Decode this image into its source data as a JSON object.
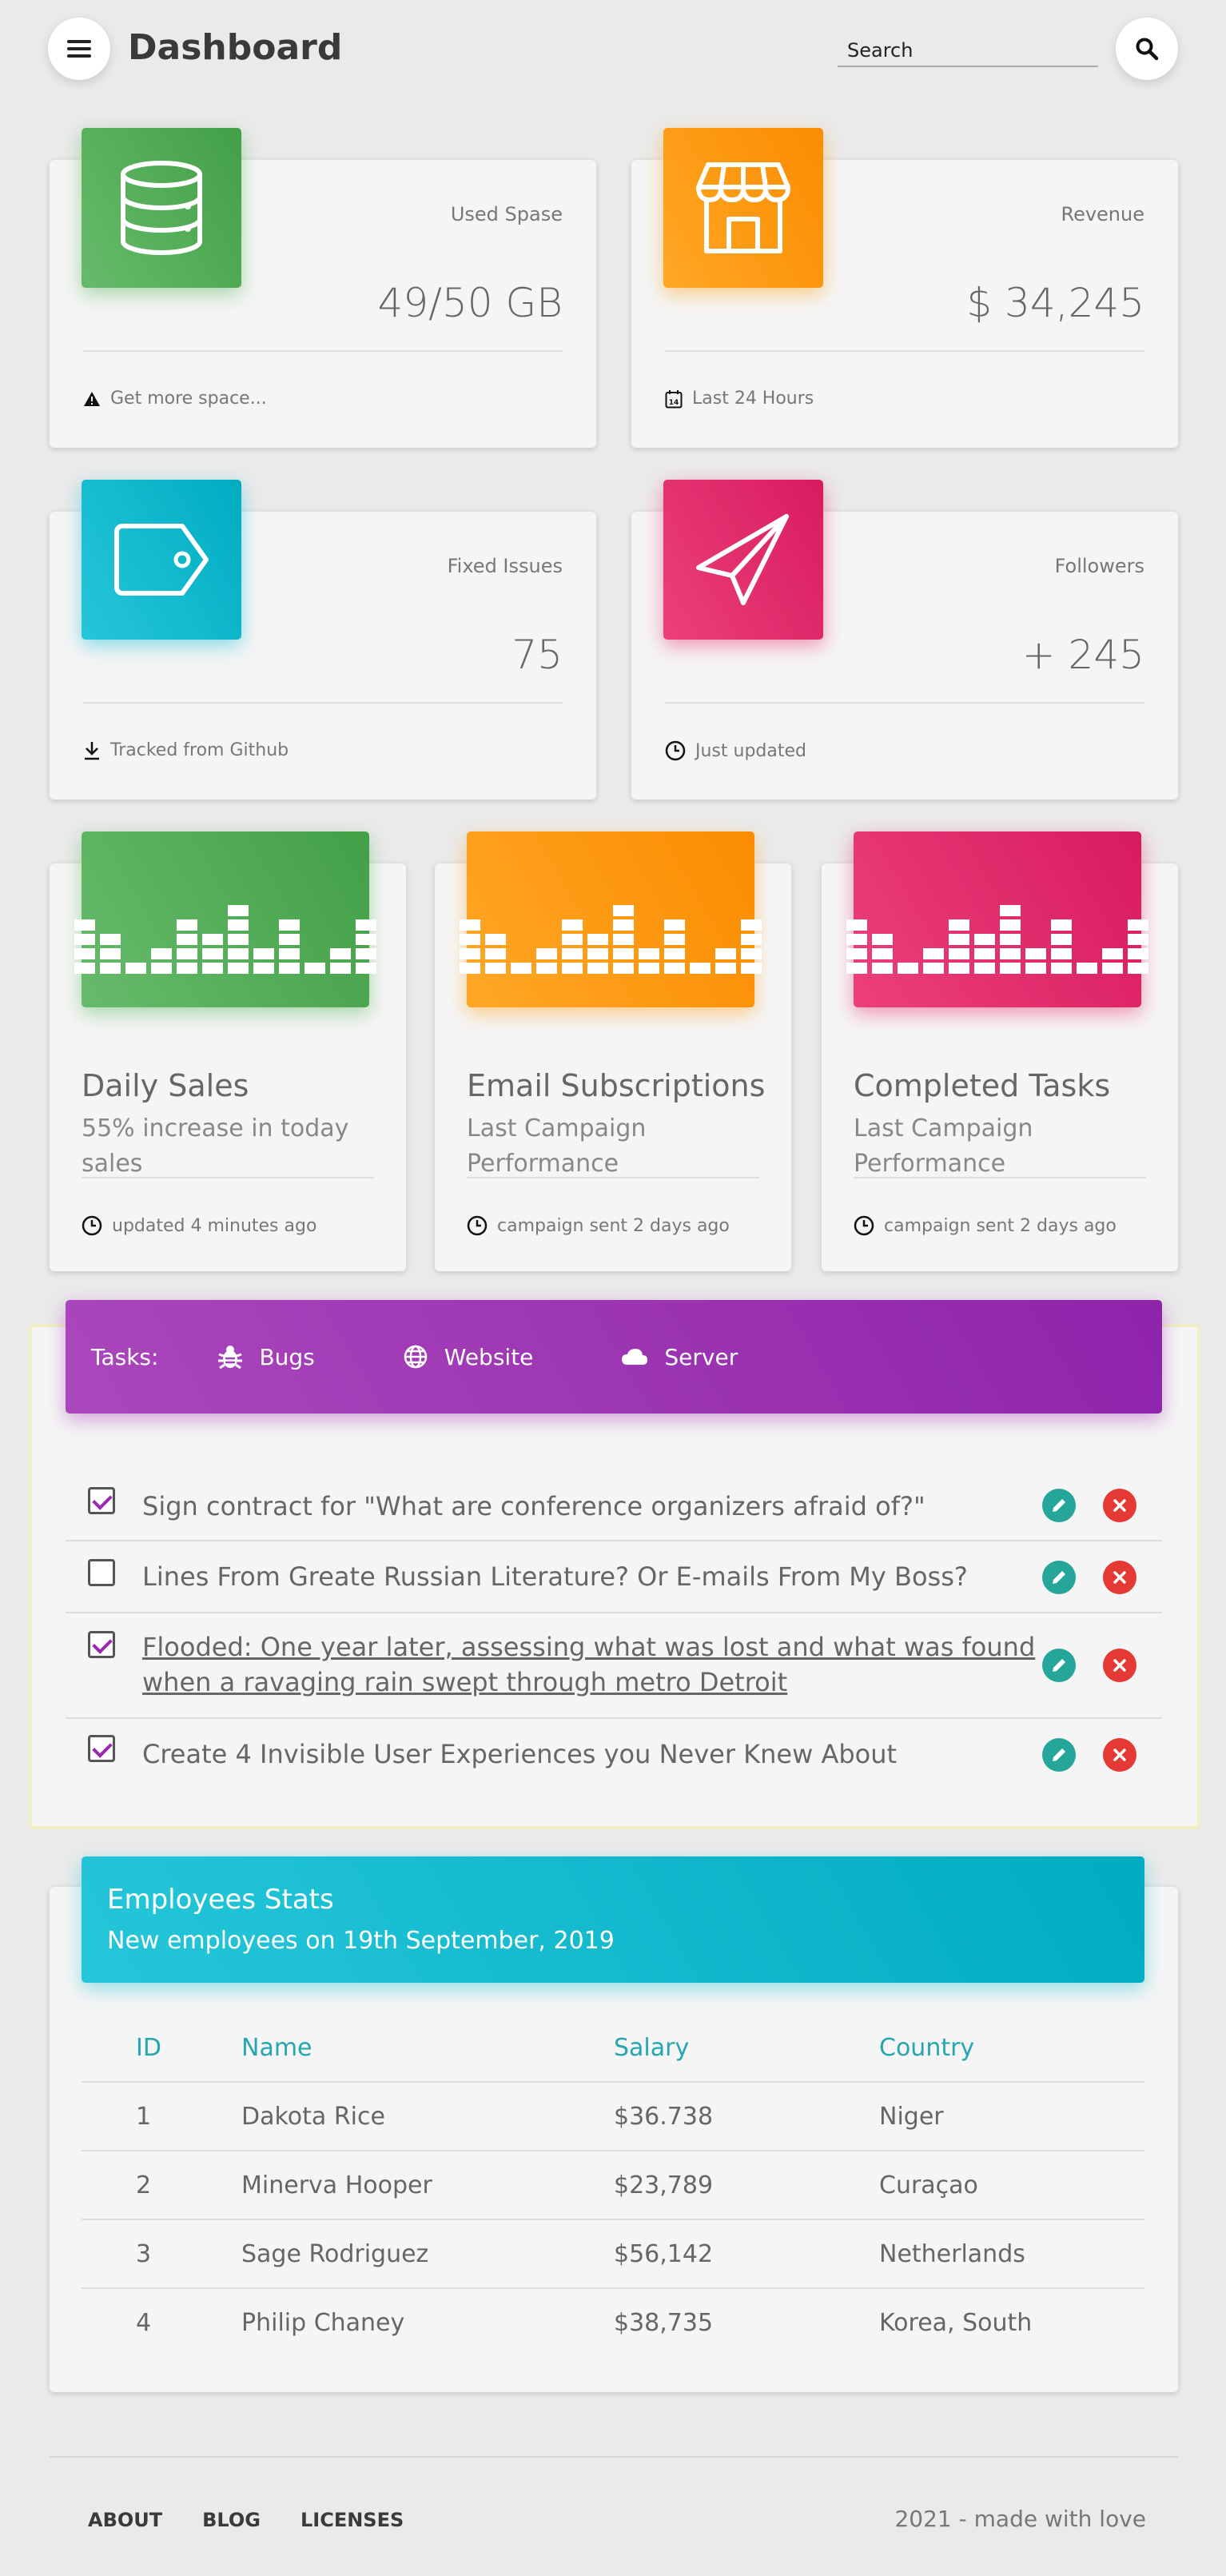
{
  "header": {
    "title": "Dashboard",
    "search_placeholder": "Search"
  },
  "stats": [
    {
      "label": "Used Spase",
      "value": "49/50 GB",
      "footer": "Get more space...",
      "icon": "database-icon",
      "footer_icon": "warning-icon",
      "color": "green"
    },
    {
      "label": "Revenue",
      "value": "$ 34,245",
      "footer": "Last 24 Hours",
      "icon": "store-icon",
      "footer_icon": "calendar-icon",
      "color": "orange"
    },
    {
      "label": "Fixed Issues",
      "value": "75",
      "footer": "Tracked from Github",
      "icon": "tag-icon",
      "footer_icon": "download-icon",
      "color": "cyan"
    },
    {
      "label": "Followers",
      "value": "+ 245",
      "footer": "Just updated",
      "icon": "paper-plane-icon",
      "footer_icon": "clock-icon",
      "color": "pink"
    }
  ],
  "charts": [
    {
      "title": "Daily Sales",
      "subtitle": "55% increase in today sales",
      "footer": "updated 4 minutes ago",
      "color": "green"
    },
    {
      "title": "Email Subscriptions",
      "subtitle": "Last Campaign Performance",
      "footer": "campaign sent 2 days ago",
      "color": "orange"
    },
    {
      "title": "Completed Tasks",
      "subtitle": "Last Campaign Performance",
      "footer": "campaign sent 2 days ago",
      "color": "pink"
    }
  ],
  "tasks": {
    "label": "Tasks:",
    "tabs": [
      {
        "label": "Bugs",
        "icon": "bug-icon"
      },
      {
        "label": "Website",
        "icon": "globe-icon"
      },
      {
        "label": "Server",
        "icon": "cloud-icon"
      }
    ],
    "items": [
      {
        "text": "Sign contract for \"What are conference organizers afraid of?\"",
        "checked": true
      },
      {
        "text": "Lines From Greate Russian Literature? Or E-mails From My Boss?",
        "checked": false
      },
      {
        "text": "Flooded: One year later, assessing what was lost and what was found when a ravaging rain swept through metro Detroit",
        "checked": true
      },
      {
        "text": "Create 4 Invisible User Experiences you Never Knew About",
        "checked": true
      }
    ]
  },
  "employees": {
    "title": "Employees Stats",
    "subtitle": "New employees on 19th September, 2019",
    "columns": [
      "ID",
      "Name",
      "Salary",
      "Country"
    ],
    "rows": [
      [
        "1",
        "Dakota Rice",
        "$36.738",
        "Niger"
      ],
      [
        "2",
        "Minerva Hooper",
        "$23,789",
        "Curaçao"
      ],
      [
        "3",
        "Sage Rodriguez",
        "$56,142",
        "Netherlands"
      ],
      [
        "4",
        "Philip Chaney",
        "$38,735",
        "Korea, South"
      ]
    ]
  },
  "footer": {
    "links": [
      "ABOUT",
      "BLOG",
      "LICENSES"
    ],
    "credit": "2021 - made with love"
  }
}
